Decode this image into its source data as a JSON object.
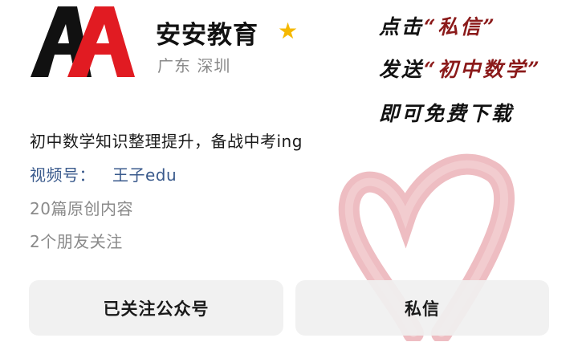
{
  "profile": {
    "name": "安安教育",
    "location": "广东 深圳",
    "intro": "初中数学知识整理提升，备战中考ing",
    "video_label": "视频号：",
    "video_value": "王子edu",
    "articles": "20篇原创内容",
    "friends": "2个朋友关注",
    "logo_text": "AA"
  },
  "promo": {
    "line1_prefix": "点击",
    "line1_quote": "“私信”",
    "line2_prefix": "发送",
    "line2_quote": "“初中数学”",
    "line3": "即可免费下载"
  },
  "actions": {
    "follow_label": "已关注公众号",
    "message_label": "私信"
  },
  "colors": {
    "star": "#f5b800",
    "highlight": "#8b1a1a",
    "link": "#3a5a8c",
    "heart": "#e8a7ad",
    "logo_black": "#111111",
    "logo_red": "#e11b22"
  },
  "icons": {
    "verified": "star-icon",
    "decor": "heart-brush-stroke"
  }
}
